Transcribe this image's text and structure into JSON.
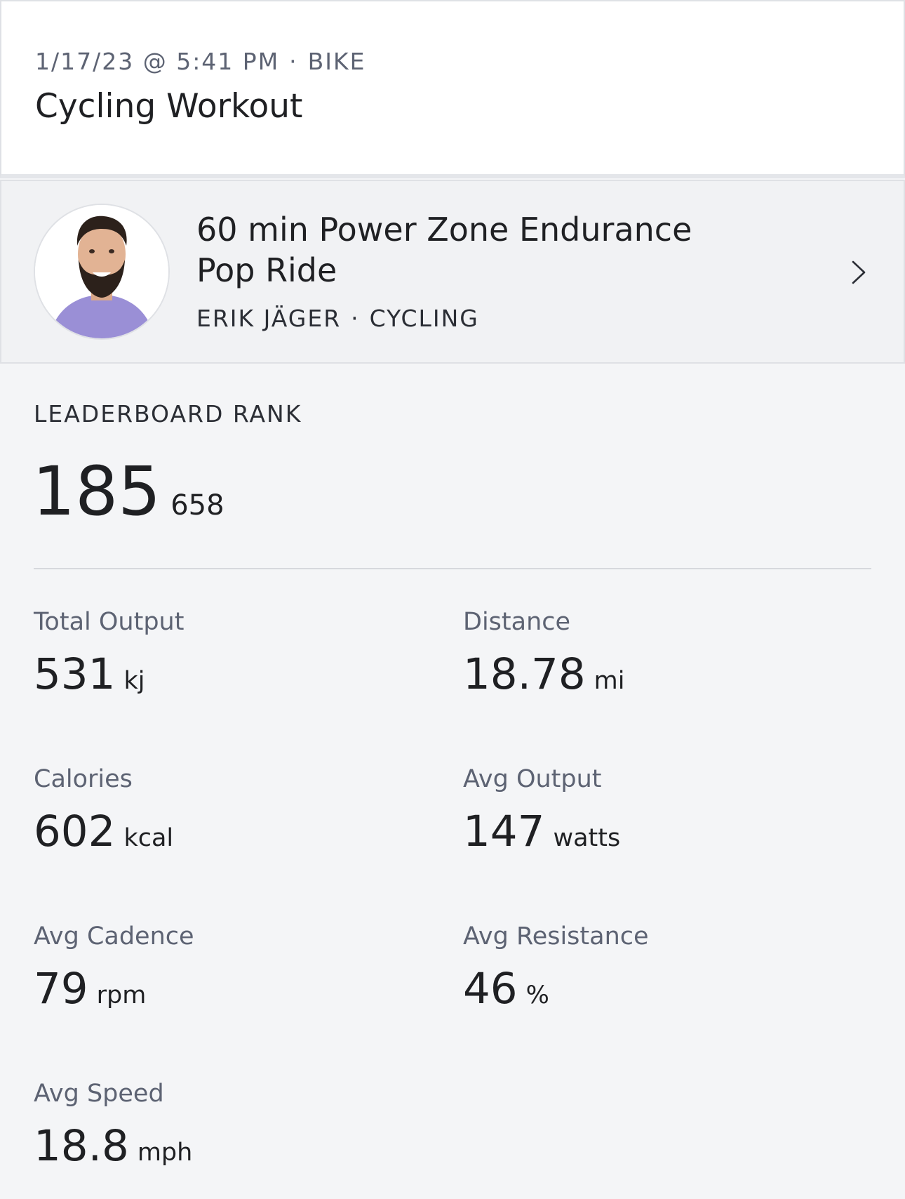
{
  "header": {
    "datetime": "1/17/23 @ 5:41 PM",
    "separator": "·",
    "device": "BIKE",
    "title": "Cycling Workout"
  },
  "class_card": {
    "title": "60 min Power Zone Endurance Pop Ride",
    "instructor": "ERIK JÄGER",
    "separator": "·",
    "discipline": "CYCLING",
    "avatar_icon": "instructor-avatar",
    "chevron_icon": "chevron-right-icon"
  },
  "leaderboard": {
    "label": "LEADERBOARD RANK",
    "rank": "185",
    "total": "658"
  },
  "metrics": [
    {
      "label": "Total Output",
      "value": "531",
      "unit": "kj"
    },
    {
      "label": "Distance",
      "value": "18.78",
      "unit": "mi"
    },
    {
      "label": "Calories",
      "value": "602",
      "unit": "kcal"
    },
    {
      "label": "Avg Output",
      "value": "147",
      "unit": "watts"
    },
    {
      "label": "Avg Cadence",
      "value": "79",
      "unit": "rpm"
    },
    {
      "label": "Avg Resistance",
      "value": "46",
      "unit": "%"
    },
    {
      "label": "Avg Speed",
      "value": "18.8",
      "unit": "mph"
    }
  ]
}
